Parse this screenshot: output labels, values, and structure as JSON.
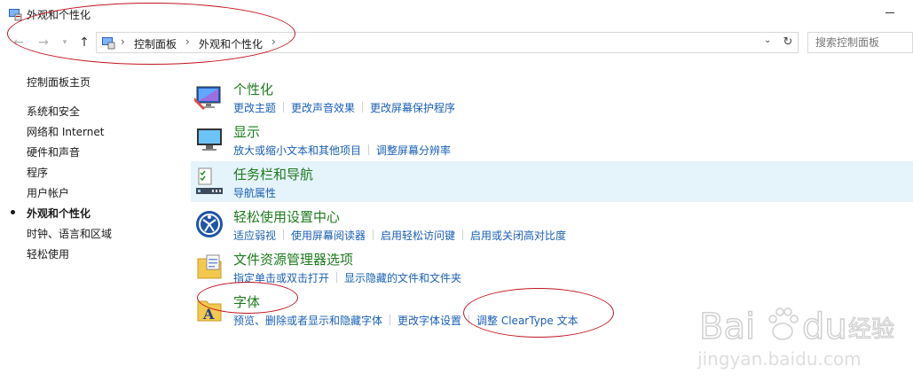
{
  "window": {
    "title": "外观和个性化"
  },
  "nav": {
    "back_icon": "back-arrow-icon",
    "forward_icon": "forward-arrow-icon",
    "recent_icon": "chevron-down-icon",
    "up_icon": "up-arrow-icon",
    "breadcrumb": [
      "控制面板",
      "外观和个性化"
    ],
    "search_placeholder": "搜索控制面板"
  },
  "sidebar": {
    "items": [
      {
        "label": "控制面板主页",
        "active": false
      },
      {
        "label": "系统和安全",
        "active": false
      },
      {
        "label": "网络和 Internet",
        "active": false
      },
      {
        "label": "硬件和声音",
        "active": false
      },
      {
        "label": "程序",
        "active": false
      },
      {
        "label": "用户帐户",
        "active": false
      },
      {
        "label": "外观和个性化",
        "active": true
      },
      {
        "label": "时钟、语言和区域",
        "active": false
      },
      {
        "label": "轻松使用",
        "active": false
      }
    ]
  },
  "categories": [
    {
      "title": "个性化",
      "icon": "personalization-icon",
      "links": [
        "更改主题",
        "更改声音效果",
        "更改屏幕保护程序"
      ]
    },
    {
      "title": "显示",
      "icon": "display-monitor-icon",
      "links": [
        "放大或缩小文本和其他项目",
        "调整屏幕分辨率"
      ]
    },
    {
      "title": "任务栏和导航",
      "icon": "taskbar-icon",
      "links": [
        "导航属性"
      ]
    },
    {
      "title": "轻松使用设置中心",
      "icon": "ease-of-access-icon",
      "links": [
        "适应弱视",
        "使用屏幕阅读器",
        "启用轻松访问键",
        "启用或关闭高对比度"
      ]
    },
    {
      "title": "文件资源管理器选项",
      "icon": "folder-options-icon",
      "links": [
        "指定单击或双击打开",
        "显示隐藏的文件和文件夹"
      ]
    },
    {
      "title": "字体",
      "icon": "fonts-icon",
      "links": [
        "预览、删除或者显示和隐藏字体",
        "更改字体设置",
        "调整 ClearType 文本"
      ]
    }
  ],
  "watermark": {
    "brand": "Bai",
    "brand2": "du",
    "cn": "经验",
    "url": "jingyan.baidu.com"
  },
  "colors": {
    "category_title": "#1e7b1e",
    "link": "#1a5fb4",
    "highlight": "#e5f3fb",
    "annotation": "#c0141e"
  }
}
